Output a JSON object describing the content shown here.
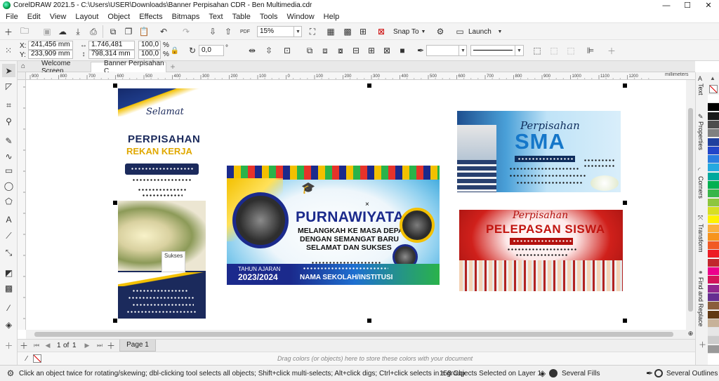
{
  "window": {
    "title": "CorelDRAW 2021.5 - C:\\Users\\USER\\Downloads\\Banner Perpisahan CDR - Ben Multimedia.cdr",
    "minimize": "—",
    "maximize": "☐",
    "close": "✕"
  },
  "menu": [
    "File",
    "Edit",
    "View",
    "Layout",
    "Object",
    "Effects",
    "Bitmaps",
    "Text",
    "Table",
    "Tools",
    "Window",
    "Help"
  ],
  "toolbar": {
    "zoom": "15%",
    "snap_to": "Snap To",
    "launch": "Launch"
  },
  "properties": {
    "x_label": "X:",
    "x": "241,456 mm",
    "y_label": "Y:",
    "y": "233,909 mm",
    "width": "1.746,481 mm",
    "height": "798,314 mm",
    "scale_x": "100,0",
    "scale_y": "100,0",
    "percent": "%",
    "rotation": "0,0",
    "rotation_unit": "°"
  },
  "tabs": {
    "welcome": "Welcome Screen",
    "document": "Banner Perpisahan C...",
    "add": "+"
  },
  "ruler": {
    "unit": "millimeters",
    "h_ticks": [
      "900",
      "800",
      "700",
      "600",
      "500",
      "400",
      "300",
      "200",
      "100",
      "0",
      "100",
      "200",
      "300",
      "400",
      "500",
      "600",
      "700",
      "800",
      "900",
      "1000",
      "1100",
      "1200"
    ]
  },
  "pages": {
    "current": "1",
    "of_label": "of",
    "total": "1",
    "tab": "Page 1"
  },
  "colorbar": {
    "hint": "Drag colors (or objects) here to store these colors with your document"
  },
  "dockers": [
    "Text",
    "Properties",
    "Corners",
    "Transform",
    "Find and Replace"
  ],
  "status": {
    "hint": "Click an object twice for rotating/skewing; dbl-clicking tool selects all objects; Shift+click multi-selects; Alt+click digs; Ctrl+click selects in a group",
    "selection": "158 Objects Selected on Layer 1",
    "fills": "Several Fills",
    "outlines": "Several Outlines"
  },
  "banners": {
    "vertical": {
      "greeting": "Selamat",
      "title": "PERPISAHAN",
      "subtitle": "REKAN KERJA",
      "badge": "Sukses"
    },
    "center": {
      "title": "PURNAWIYATA",
      "line1": "MELANGKAH KE MASA DEPAN",
      "line2": "DENGAN SEMANGAT BARU",
      "line3": "SELAMAT DAN SUKSES",
      "year_label": "TAHUN AJARAN",
      "year": "2023/2024",
      "school": "NAMA SEKOLAH/INSTITUSI"
    },
    "sma": {
      "script": "Perpisahan",
      "title": "SMA"
    },
    "siswa": {
      "script": "Perpisahan",
      "title": "PELEPASAN SISWA"
    }
  },
  "palette": [
    "#ffffff",
    "#000000",
    "#1a1a1a",
    "#4d4d4d",
    "#808080",
    "#1f3f9e",
    "#2346c9",
    "#2a7de1",
    "#25a9e0",
    "#00a99d",
    "#00b050",
    "#39b54a",
    "#8dc63f",
    "#d7df23",
    "#fff200",
    "#fbb040",
    "#f7941d",
    "#f15a24",
    "#ed1c24",
    "#c1272d",
    "#ec008c",
    "#d4145a",
    "#92278f",
    "#662d91",
    "#8b5e3c",
    "#603813",
    "#c7b299",
    "#e6e6e6",
    "#cccccc",
    "#999999"
  ]
}
